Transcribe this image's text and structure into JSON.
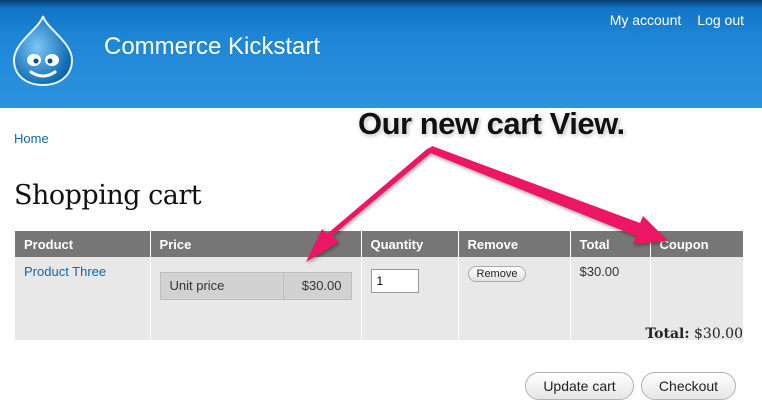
{
  "header": {
    "site_name": "Commerce Kickstart",
    "menu": {
      "my_account": "My account",
      "log_out": "Log out"
    }
  },
  "breadcrumb": {
    "home": "Home"
  },
  "page": {
    "title": "Shopping cart"
  },
  "cart": {
    "columns": [
      "Product",
      "Price",
      "Quantity",
      "Remove",
      "Total",
      "Coupon"
    ],
    "rows": [
      {
        "product": "Product Three",
        "price_label": "Unit price",
        "price_value": "$30.00",
        "quantity": "1",
        "remove_label": "Remove",
        "total": "$30.00",
        "coupon": ""
      }
    ]
  },
  "order_total": {
    "label": "Total:",
    "value": "$30.00"
  },
  "actions": {
    "update_cart": "Update cart",
    "checkout": "Checkout"
  },
  "annotation": {
    "text": "Our new cart View.",
    "color": "#ec1565"
  },
  "colors": {
    "header_blue": "#2b93df",
    "link": "#0a68b4",
    "table_header": "#767676"
  }
}
